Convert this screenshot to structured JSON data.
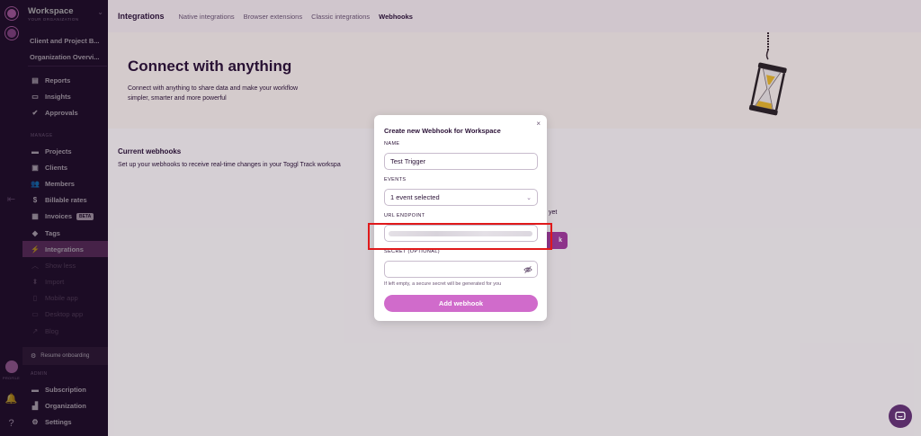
{
  "sidebar": {
    "workspace_name": "Workspace",
    "workspace_sub": "YOUR ORGANIZATION",
    "project_links": [
      "Client and Project B...",
      "Organization Overvi..."
    ],
    "main_items": [
      {
        "label": "Reports",
        "icon": "reports-icon"
      },
      {
        "label": "Insights",
        "icon": "insights-icon"
      },
      {
        "label": "Approvals",
        "icon": "approvals-icon"
      }
    ],
    "manage_label": "MANAGE",
    "manage_items": [
      {
        "label": "Projects",
        "icon": "folder-icon"
      },
      {
        "label": "Clients",
        "icon": "clients-icon"
      },
      {
        "label": "Members",
        "icon": "members-icon"
      },
      {
        "label": "Billable rates",
        "icon": "billable-rates-icon"
      },
      {
        "label": "Invoices",
        "icon": "invoices-icon",
        "badge": "BETA"
      },
      {
        "label": "Tags",
        "icon": "tag-icon"
      },
      {
        "label": "Integrations",
        "icon": "integrations-icon",
        "active": true
      },
      {
        "label": "Show less",
        "icon": "chevron-up-icon"
      },
      {
        "label": "Import",
        "icon": "import-icon"
      },
      {
        "label": "Mobile app",
        "icon": "mobile-icon"
      },
      {
        "label": "Desktop app",
        "icon": "desktop-icon"
      },
      {
        "label": "Blog",
        "icon": "external-link-icon"
      }
    ],
    "resume_label": "Resume onboarding",
    "admin_label": "ADMIN",
    "admin_items": [
      {
        "label": "Subscription",
        "icon": "subscription-icon"
      },
      {
        "label": "Organization",
        "icon": "organization-icon"
      },
      {
        "label": "Settings",
        "icon": "gear-icon"
      }
    ],
    "profile_label": "PROFILE"
  },
  "topbar": {
    "title": "Integrations",
    "tabs": [
      "Native integrations",
      "Browser extensions",
      "Classic integrations",
      "Webhooks"
    ],
    "active_tab": "Webhooks"
  },
  "hero": {
    "title": "Connect with anything",
    "description": "Connect with anything to share data and make your workflow simpler, smarter and more powerful"
  },
  "current_webhooks": {
    "title": "Current webhooks",
    "description": "Set up your webhooks to receive real-time changes in your Toggl Track workspa",
    "empty_fragment": "yet",
    "button_fragment": "k"
  },
  "modal": {
    "title": "Create new Webhook for Workspace",
    "close_glyph": "×",
    "name_label": "NAME",
    "name_value": "Test Trigger",
    "events_label": "EVENTS",
    "events_value": "1 event selected",
    "url_label": "URL ENDPOINT",
    "secret_label": "SECRET (OPTIONAL)",
    "secret_hint": "If left empty, a secure secret will be generated for you",
    "submit_label": "Add webhook"
  },
  "colors": {
    "sidebar_bg": "#2c1338",
    "active_item": "#7a3d7b",
    "primary_button": "#d06bcb",
    "highlight": "#e0191b"
  }
}
